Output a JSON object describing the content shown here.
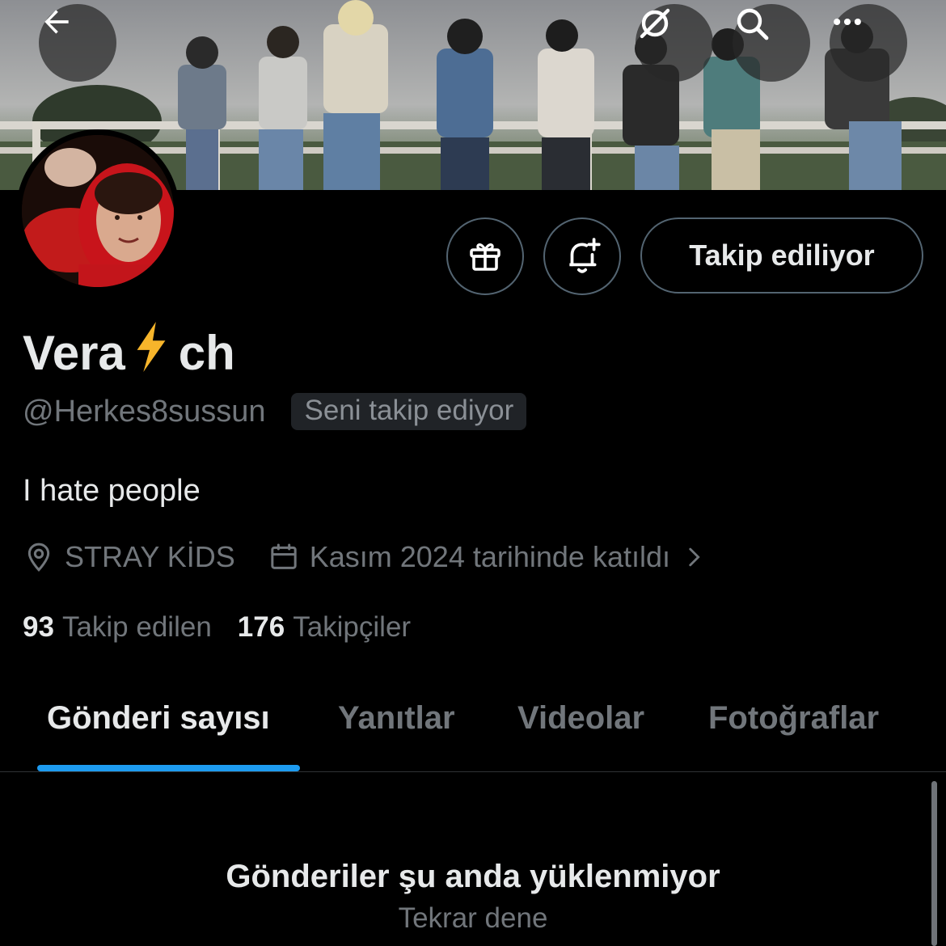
{
  "profile": {
    "name_start": "Vera",
    "name_emoji": "⚡",
    "name_end": "ch",
    "handle": "@Herkes8sussun",
    "follows_you": "Seni takip ediyor",
    "bio": "I hate people",
    "location": "STRAY KİDS",
    "joined": "Kasım 2024 tarihinde katıldı",
    "following_count": "93",
    "following_label": "Takip edilen",
    "followers_count": "176",
    "followers_label": "Takipçiler"
  },
  "header_buttons": {
    "back": "back-arrow-icon",
    "grok": "grok-icon",
    "search": "search-icon",
    "more": "more-icon"
  },
  "actions": {
    "gift": "gift-icon",
    "notify": "bell-plus-icon",
    "follow_label": "Takip ediliyor"
  },
  "tabs": [
    {
      "label": "Gönderi sayısı",
      "active": true
    },
    {
      "label": "Yanıtlar",
      "active": false
    },
    {
      "label": "Videolar",
      "active": false
    },
    {
      "label": "Fotoğraflar",
      "active": false
    }
  ],
  "empty_state": {
    "title": "Gönderiler şu anda yüklenmiyor",
    "retry": "Tekrar dene"
  },
  "colors": {
    "background": "#000000",
    "text_primary": "#e7e9ea",
    "text_secondary": "#71767b",
    "accent": "#1d9bf0",
    "border": "#2f3336"
  }
}
